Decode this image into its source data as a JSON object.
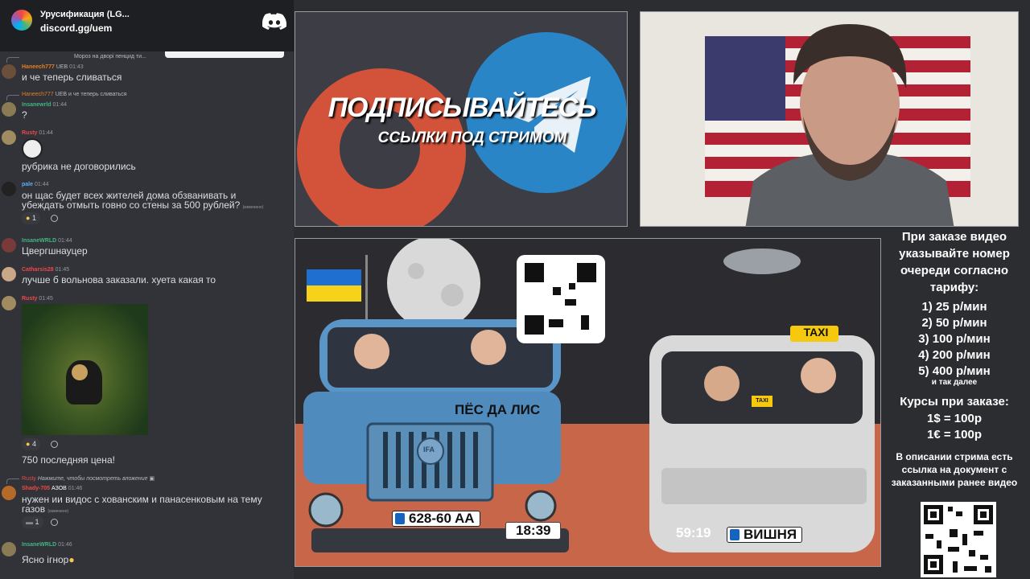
{
  "chat": {
    "server_name": "Урусификация (LG...",
    "server_link": "discord.gg/uem",
    "messages": [
      {
        "type": "reply-top",
        "reply_text": "Мороз на дворі пенцид ти...",
        "time": ""
      },
      {
        "type": "msg",
        "nick": "Haneech777",
        "badge": "UEB",
        "time": "01:43",
        "text": "и че теперь сливаться"
      },
      {
        "type": "reply-top",
        "reply_nick": "Haneech777",
        "reply_badge": "UEB",
        "reply_text": "и че теперь сливаться"
      },
      {
        "type": "msg",
        "nick": "Insanewrld",
        "time": "01:44",
        "text": "?"
      },
      {
        "type": "msg",
        "nick": "Rusty",
        "time": "01:44",
        "text": "рубрика не договорились"
      },
      {
        "type": "msg",
        "nick": "pale",
        "time": "01:44",
        "text_line1": "он щас будет всех жителей дома обзванивать и",
        "text_line2": "убеждать отмыть говно со стены за 500 рублей?",
        "edited": "(изменено)",
        "reaction_count": "1"
      },
      {
        "type": "msg",
        "nick": "InsaneWRLD",
        "time": "01:44",
        "text": "Цвергшнауцер"
      },
      {
        "type": "msg",
        "nick": "Catharsis28",
        "time": "01:45",
        "text": "лучше б вольнова заказали. хуета какая то"
      },
      {
        "type": "msg",
        "nick": "Rusty",
        "time": "01:45",
        "reaction_count": "4",
        "text": "750 последняя цена!"
      },
      {
        "type": "reply-top",
        "reply_nick": "Rusty",
        "reply_text": "Нажмите, чтобы посмотреть вложение"
      },
      {
        "type": "msg",
        "nick": "Shady-705",
        "badge": "АЗОВ",
        "time": "01:46",
        "text_line1": "нужен ии видос с хованским и панасенковым на тему",
        "text_line2": "газов",
        "edited": "(изменено)",
        "reaction_count": "1"
      },
      {
        "type": "msg",
        "nick": "InsaneWRLD",
        "time": "01:46",
        "text": "Ясно ігнор"
      }
    ]
  },
  "promo": {
    "title": "ПОДПИСЫВАЙТЕСЬ",
    "subtitle": "ССЫЛКИ ПОД СТРИМОМ"
  },
  "artwork": {
    "truck_label": "ПЁС ДА ЛИС",
    "taxi_sign": "TAXI",
    "left_plate": "628-60 AA",
    "left_plate_country": "UA",
    "left_timer": "18:39",
    "right_timer": "59:19",
    "right_plate": "ВИШНЯ",
    "truck_brand": "IFA",
    "small_taxi_sign": "TAXI"
  },
  "info": {
    "heading": "При заказе видео указывайте номер очереди согласно тарифу:",
    "tariffs": [
      "1) 25 р/мин",
      "2) 50 р/мин",
      "3) 100 р/мин",
      "4) 200 р/мин",
      "5) 400 р/мин"
    ],
    "tariffs_more": "и так далее",
    "rates_heading": "Курсы при заказе:",
    "rate_usd": "1$ = 100р",
    "rate_eur": "1€ = 100р",
    "doc_note": "В описании стрима есть ссылка на документ с заказанными ранее видео"
  },
  "colors": {
    "chat_bg": "#313338",
    "server_bar": "#1e1f22",
    "nick_orange": "#e67e22",
    "nick_red": "#f04747",
    "nick_green": "#43b581",
    "nick_blue": "#5dadec"
  }
}
